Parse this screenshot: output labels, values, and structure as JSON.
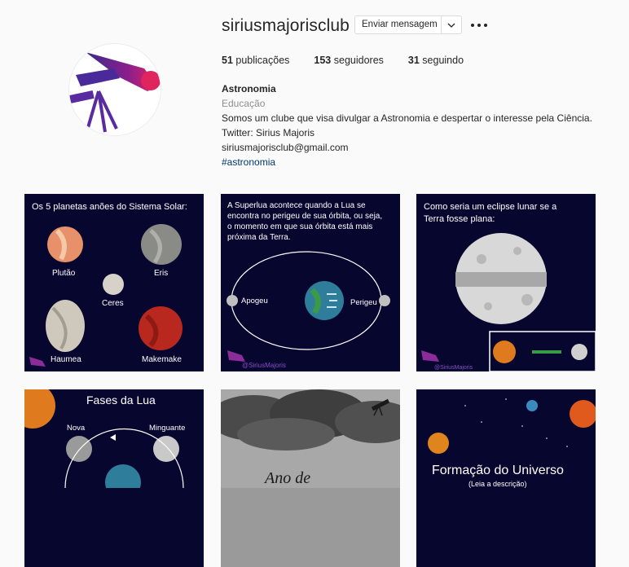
{
  "profile": {
    "username": "siriusmajorisclub",
    "message_button": "Enviar mensagem",
    "stats": {
      "posts_count": "51",
      "posts_label": "publicações",
      "followers_count": "153",
      "followers_label": "seguidores",
      "following_count": "31",
      "following_label": "seguindo"
    },
    "bio": {
      "name": "Astronomia",
      "category": "Educação",
      "line1": "Somos um clube que visa divulgar a Astronomia e despertar o interesse pela Ciência.",
      "line2": "Twitter: Sirius Majoris",
      "email": "siriusmajorisclub@gmail.com",
      "hashtag": "#astronomia"
    }
  },
  "posts": [
    {
      "title": "Os 5 planetas anões do Sistema Solar:",
      "labels": [
        "Plutão",
        "Eris",
        "Ceres",
        "Haumea",
        "Makemake"
      ]
    },
    {
      "title_lines": [
        "A Superlua acontece quando a Lua se",
        "encontra no perigeu de sua órbita, ou seja,",
        "o momento em que sua órbita está mais",
        "próxima da Terra."
      ],
      "label_left": "Apogeu",
      "label_right": "Perigeu",
      "handle": "@SiriusMajoris"
    },
    {
      "title_lines": [
        "Como seria um eclipse lunar se a",
        "Terra fosse plana:"
      ],
      "handle": "@SiriusMajoris"
    },
    {
      "title": "Fases da Lua",
      "label_left": "Nova",
      "label_right": "Minguante"
    },
    {
      "title": "Ano de"
    },
    {
      "title": "Formação do Universo",
      "subtitle": "(Leia a descrição)"
    }
  ],
  "colors": {
    "tile_bg": "#06062e",
    "link": "#00376b",
    "muted": "#8e8e8e"
  }
}
